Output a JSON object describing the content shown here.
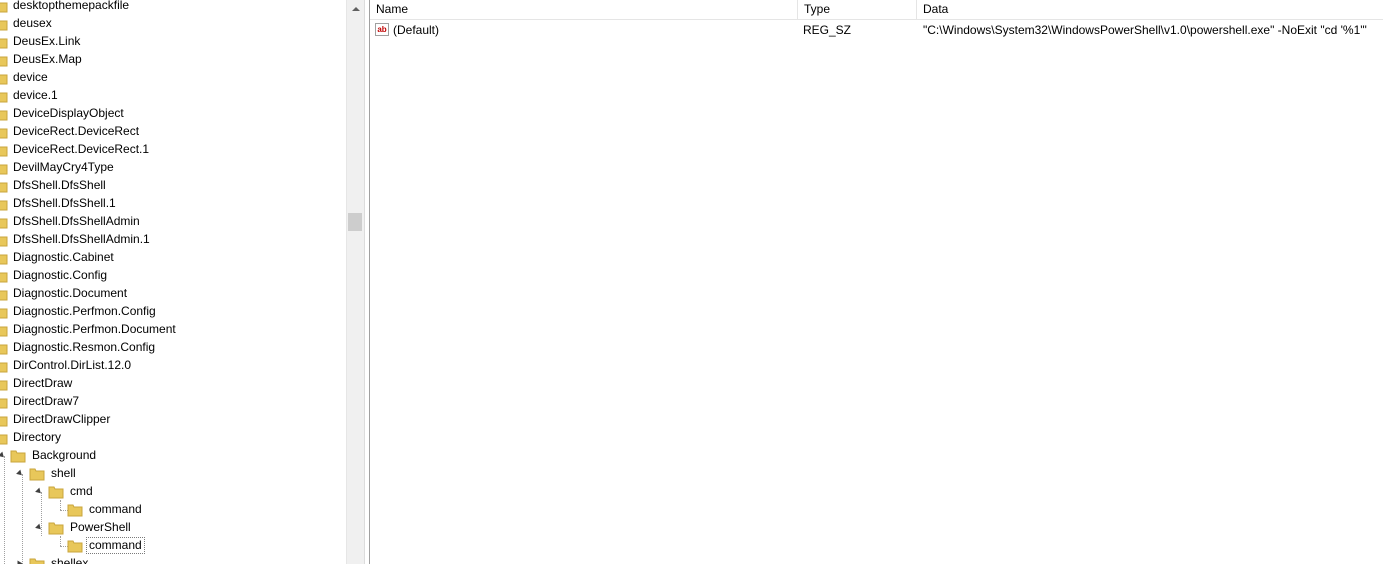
{
  "tree": {
    "items": [
      "desktopthemepackfile",
      "deusex",
      "DeusEx.Link",
      "DeusEx.Map",
      "device",
      "device.1",
      "DeviceDisplayObject",
      "DeviceRect.DeviceRect",
      "DeviceRect.DeviceRect.1",
      "DevilMayCry4Type",
      "DfsShell.DfsShell",
      "DfsShell.DfsShell.1",
      "DfsShell.DfsShellAdmin",
      "DfsShell.DfsShellAdmin.1",
      "Diagnostic.Cabinet",
      "Diagnostic.Config",
      "Diagnostic.Document",
      "Diagnostic.Perfmon.Config",
      "Diagnostic.Perfmon.Document",
      "Diagnostic.Resmon.Config",
      "DirControl.DirList.12.0",
      "DirectDraw",
      "DirectDraw7",
      "DirectDrawClipper",
      "Directory"
    ],
    "expanded": {
      "background": "Background",
      "shell": "shell",
      "cmd": "cmd",
      "cmd_command": "command",
      "powershell": "PowerShell",
      "powershell_command": "command",
      "shellex": "shellex"
    }
  },
  "list": {
    "columns": {
      "name": "Name",
      "type": "Type",
      "data": "Data"
    },
    "rows": [
      {
        "icon": "ab",
        "name": "(Default)",
        "type": "REG_SZ",
        "data": "\"C:\\Windows\\System32\\WindowsPowerShell\\v1.0\\powershell.exe\" -NoExit \"cd '%1'\""
      }
    ]
  },
  "colors": {
    "folder": "#e8c75a",
    "selection_border": "#7a7a7a",
    "ab_icon": "#c00000"
  }
}
